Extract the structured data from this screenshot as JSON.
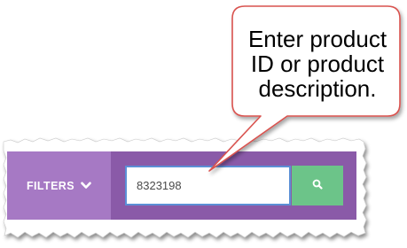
{
  "toolbar": {
    "filters_label": "FILTERS",
    "search": {
      "value": "8323198",
      "placeholder": ""
    },
    "search_icon": "search-icon",
    "filters_icon": "chevron-down-icon"
  },
  "callout": {
    "text": "Enter product ID or product description."
  },
  "colors": {
    "toolbar_bg": "#8a5aa8",
    "filters_bg": "#a679c4",
    "search_border": "#5c8fd6",
    "search_button": "#6cc489",
    "callout_border": "#d9534f"
  }
}
